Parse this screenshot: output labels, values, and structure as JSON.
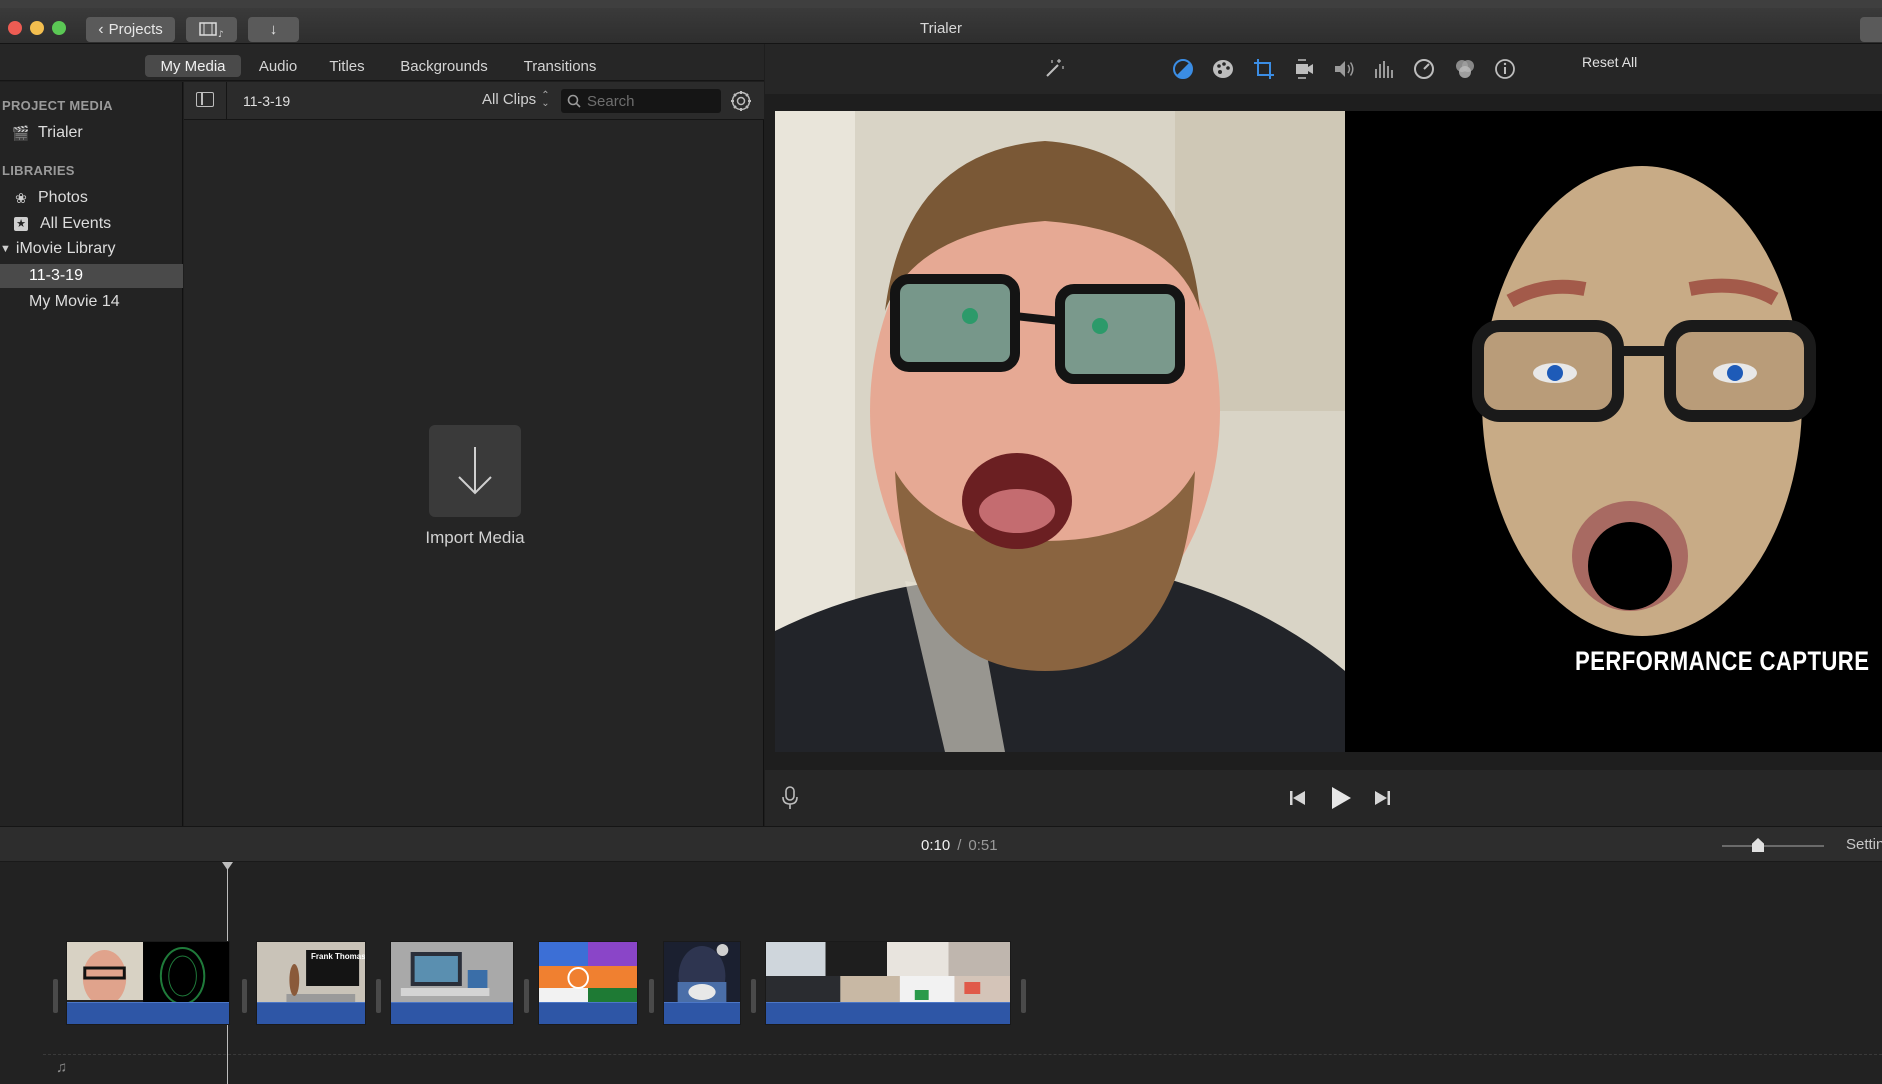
{
  "window": {
    "title": "Trialer"
  },
  "titlebar": {
    "projects_label": "Projects"
  },
  "tabs": [
    {
      "label": "My Media",
      "active": true
    },
    {
      "label": "Audio",
      "active": false
    },
    {
      "label": "Titles",
      "active": false
    },
    {
      "label": "Backgrounds",
      "active": false
    },
    {
      "label": "Transitions",
      "active": false
    }
  ],
  "sidebar": {
    "project_media_heading": "PROJECT MEDIA",
    "project_item": "Trialer",
    "libraries_heading": "LIBRARIES",
    "photos": "Photos",
    "all_events": "All Events",
    "library": "iMovie Library",
    "events": [
      "11-3-19",
      "My Movie 14"
    ],
    "selected_event": "11-3-19"
  },
  "browser": {
    "event_name": "11-3-19",
    "filter": "All Clips",
    "search_placeholder": "Search",
    "import_label": "Import Media"
  },
  "viewer": {
    "reset_all": "Reset All",
    "overlay_text": "PERFORMANCE CAPTURE",
    "tools": [
      "magic-wand-icon",
      "color-balance-icon",
      "color-correction-icon",
      "crop-icon",
      "stabilization-icon",
      "volume-icon",
      "noise-reduction-icon",
      "speed-icon",
      "clip-filter-icon",
      "info-icon"
    ]
  },
  "playback": {
    "current_time": "0:10",
    "separator": "/",
    "total_time": "0:51",
    "settings": "Settings"
  },
  "timeline": {
    "clip_count": 6,
    "clip2_title": "Frank Thomas"
  },
  "colors": {
    "accent_blue": "#2e56a6",
    "close": "#ee5c53",
    "minimize": "#f3be4f",
    "zoom": "#5bc855"
  }
}
